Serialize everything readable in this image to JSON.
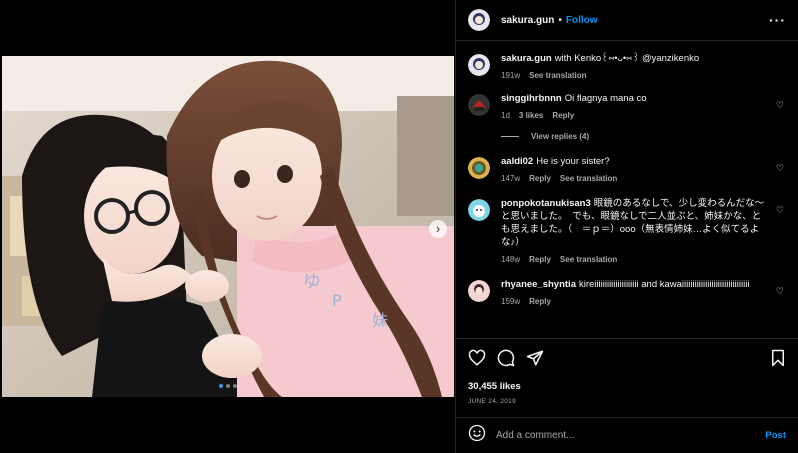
{
  "post": {
    "username": "sakura.gun",
    "separator": "•",
    "follow_label": "Follow",
    "more_icon": "more-horizontal-icon",
    "caption": {
      "username": "sakura.gun",
      "text": "with Kenko꒰⑅•ᴗ•⑅꒱ @yanzikenko",
      "age": "191w",
      "see_translation": "See translation"
    },
    "comments": [
      {
        "username": "singgihrbnnn",
        "text": "Oi flagnya mana co",
        "age": "1d",
        "likes": "3 likes",
        "reply": "Reply",
        "see_translation": "",
        "view_replies": "View replies (4)"
      },
      {
        "username": "aaldi02",
        "text": "He is your sister?",
        "age": "147w",
        "likes": "",
        "reply": "Reply",
        "see_translation": "See translation",
        "view_replies": ""
      },
      {
        "username": "ponpokotanukisan3",
        "text": "眼鏡のあるなしで、少し変わるんだな〜と思いました。　でも、眼鏡なしで二人並ぶと、姉妹かな、とも思えました。（　＝ｐ＝）ooo（無表情姉妹…よく似てるよな♪）",
        "age": "148w",
        "likes": "",
        "reply": "Reply",
        "see_translation": "See translation",
        "view_replies": ""
      },
      {
        "username": "rhyanee_shyntia",
        "text": "kireiiiiiiiiiiiiiiiiiiiii and kawaiiiiiiiiiiiiiiiiiiiiiiiiiiiiiiii",
        "age": "159w",
        "likes": "",
        "reply": "Reply",
        "see_translation": "",
        "view_replies": ""
      }
    ],
    "likes": "30,455 likes",
    "date": "JUNE 24, 2019",
    "add_comment_placeholder": "Add a comment...",
    "post_label": "Post",
    "carousel": {
      "slides": 3,
      "active": 1
    },
    "colors": {
      "accent": "#0095f6",
      "background": "#000000",
      "muted": "#a8a8a8",
      "divider": "#262626"
    }
  }
}
